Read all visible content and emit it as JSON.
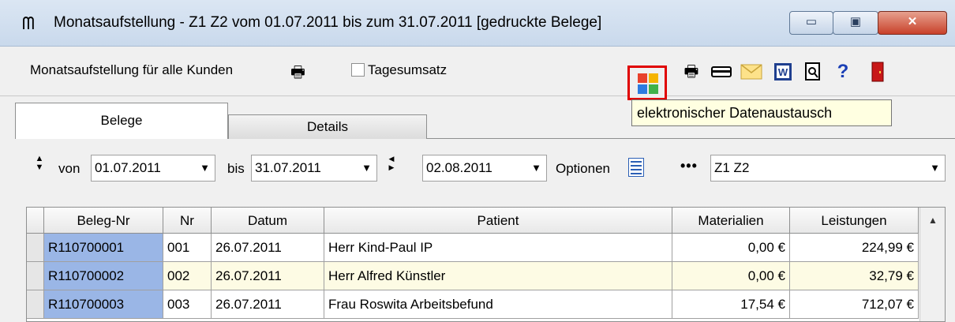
{
  "window": {
    "title": "Monatsaufstellung - Z1 Z2 vom 01.07.2011 bis zum 31.07.2011  [gedruckte Belege]",
    "app_icon": "tooth-icon",
    "controls": {
      "minimize": "▭",
      "maximize": "▣",
      "close": "✕"
    }
  },
  "toolbar": {
    "label": "Monatsaufstellung für alle Kunden",
    "checkbox_label": "Tagesumsatz",
    "checkbox_checked": false,
    "icons": [
      "printer-icon",
      "electronic-data-exchange-icon",
      "printer-icon",
      "card-icon",
      "mail-icon",
      "word-icon",
      "preview-icon",
      "help-icon",
      "exit-door-icon"
    ],
    "tooltip": "elektronischer Datenaustausch",
    "help_glyph": "?"
  },
  "tabs": [
    {
      "label": "Belege",
      "active": true
    },
    {
      "label": "Details",
      "active": false
    }
  ],
  "filters": {
    "von_label": "von",
    "von_value": "01.07.2011",
    "bis_label": "bis",
    "bis_value": "31.07.2011",
    "date_value": "02.08.2011",
    "optionen_label": "Optionen",
    "dots": "•••",
    "group_value": "Z1 Z2"
  },
  "table": {
    "columns": [
      "Beleg-Nr",
      "Nr",
      "Datum",
      "Patient",
      "Materialien",
      "Leistungen"
    ],
    "rows": [
      {
        "beleg": "R110700001",
        "nr": "001",
        "datum": "26.07.2011",
        "patient": "Herr Kind-Paul IP",
        "materialien": "0,00 €",
        "leistungen": "224,99 €"
      },
      {
        "beleg": "R110700002",
        "nr": "002",
        "datum": "26.07.2011",
        "patient": "Herr Alfred Künstler",
        "materialien": "0,00 €",
        "leistungen": "32,79 €"
      },
      {
        "beleg": "R110700003",
        "nr": "003",
        "datum": "26.07.2011",
        "patient": "Frau Roswita Arbeitsbefund",
        "materialien": "17,54 €",
        "leistungen": "712,07 €"
      }
    ]
  },
  "colors": {
    "highlight_row": "#fdfbe4",
    "beleg_cell": "#9ab6e6",
    "tooltip_bg": "#ffffe1",
    "edx_red_frame": "#e00000"
  }
}
